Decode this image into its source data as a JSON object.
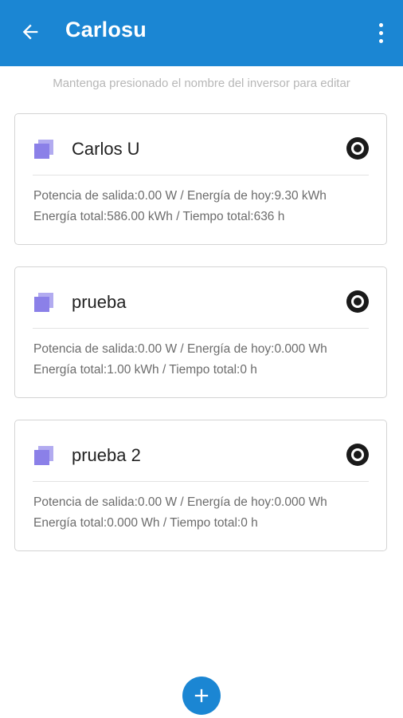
{
  "appbar": {
    "title": "Carlosu",
    "back_icon": "arrow-left-icon",
    "menu_icon": "more-vert-icon",
    "color": "#1b86d3"
  },
  "hint": "Mantenga presionado el nombre del inversor para editar",
  "inverters": [
    {
      "name": "Carlos U",
      "line1": "Potencia de salida:0.00 W / Energía de hoy:9.30 kWh",
      "line2": "Energía total:586.00 kWh / Tiempo total:636 h"
    },
    {
      "name": "prueba",
      "line1": "Potencia de salida:0.00 W / Energía de hoy:0.000 Wh",
      "line2": "Energía total:1.00 kWh / Tiempo total:0 h"
    },
    {
      "name": "prueba 2",
      "line1": "Potencia de salida:0.00 W / Energía de hoy:0.000 Wh",
      "line2": "Energía total:0.000 Wh / Tiempo total:0 h"
    }
  ],
  "card_icon": "inverter-stack-icon",
  "card_icon_color": "#8b80e8",
  "target_icon": "target-icon",
  "fab_icon": "add-icon"
}
